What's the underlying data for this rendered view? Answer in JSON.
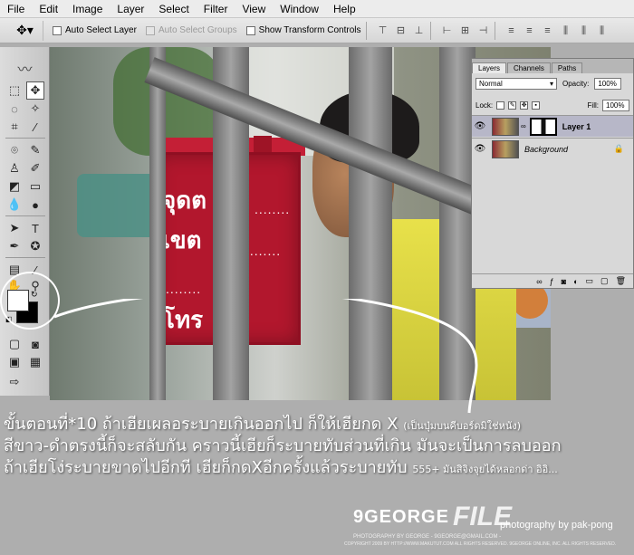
{
  "menu": [
    "File",
    "Edit",
    "Image",
    "Layer",
    "Select",
    "Filter",
    "View",
    "Window",
    "Help"
  ],
  "options": {
    "auto_select_layer": "Auto Select Layer",
    "auto_select_groups": "Auto Select Groups",
    "show_transform": "Show Transform Controls"
  },
  "sign": {
    "line1": "จุดต",
    "line2": "เขต",
    "line3": "โทร",
    "dots": "........"
  },
  "layers": {
    "tabs": [
      "Layers",
      "Channels",
      "Paths"
    ],
    "blend_mode": "Normal",
    "opacity_label": "Opacity:",
    "opacity_value": "100%",
    "lock_label": "Lock:",
    "fill_label": "Fill:",
    "fill_value": "100%",
    "items": [
      {
        "name": "Layer 1"
      },
      {
        "name": "Background"
      }
    ]
  },
  "tutorial": {
    "line1": "ขั้นตอนที่*10 ถ้าเฮียเผลอระบายเกินออกไป ก็ให้เฮียกด X",
    "line1_small": "(เป็นปุ่มบนคีบอร์ดมิใช่หนัง)",
    "line2": "สีขาว-ดำตรงนี้ก็จะสลับกัน คราวนี้เฮียก็ระบายทับส่วนที่เกิน มันจะเป็นการลบออก",
    "line3": "ถ้าเฮียโง่ระบายขาดไปอีกที เฮียก็กดXอีกครั้งแล้วระบายทับ",
    "line3_small": "555+ มันสิจิงจุยได้หลอกด่า อิอิ..."
  },
  "footer": {
    "brand": "9GEORGE",
    "brand2": "FILE",
    "photog": "photography by pak-pong",
    "small": "PHOTOGRAPHY BY GEORGE - 9GEORGE@GMAIL.COM -",
    "copy": "COPYRIGHT 2009 BY HTTP://WWW.MAKUTUT.COM ALL RIGHTS RESERVED. 9GEORGE ONLINE, INC. ALL RIGHTS RESERVED."
  }
}
